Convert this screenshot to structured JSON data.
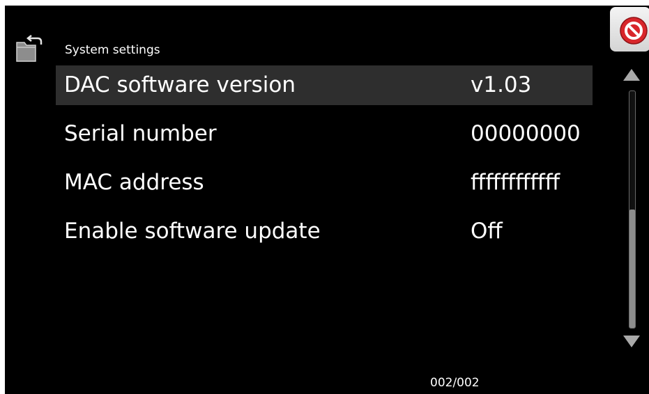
{
  "header": {
    "title": "System settings",
    "back_icon": "folder-back-icon",
    "close_icon": "close-icon"
  },
  "settings": [
    {
      "label": "DAC software version",
      "value": "v1.03",
      "selected": true
    },
    {
      "label": "Serial number",
      "value": "00000000",
      "selected": false
    },
    {
      "label": "MAC address",
      "value": "ffffffffffff",
      "selected": false
    },
    {
      "label": "Enable software update",
      "value": "Off",
      "selected": false
    }
  ],
  "scrollbar": {
    "up_icon": "arrow-up-icon",
    "down_icon": "arrow-down-icon",
    "position_fraction": 1.0,
    "visible_fraction": 0.5
  },
  "footer": {
    "page_indicator": "002/002"
  },
  "colors": {
    "background": "#000000",
    "text": "#ffffff",
    "selected_row": "#2e2e2e",
    "close_red": "#d8262b"
  }
}
